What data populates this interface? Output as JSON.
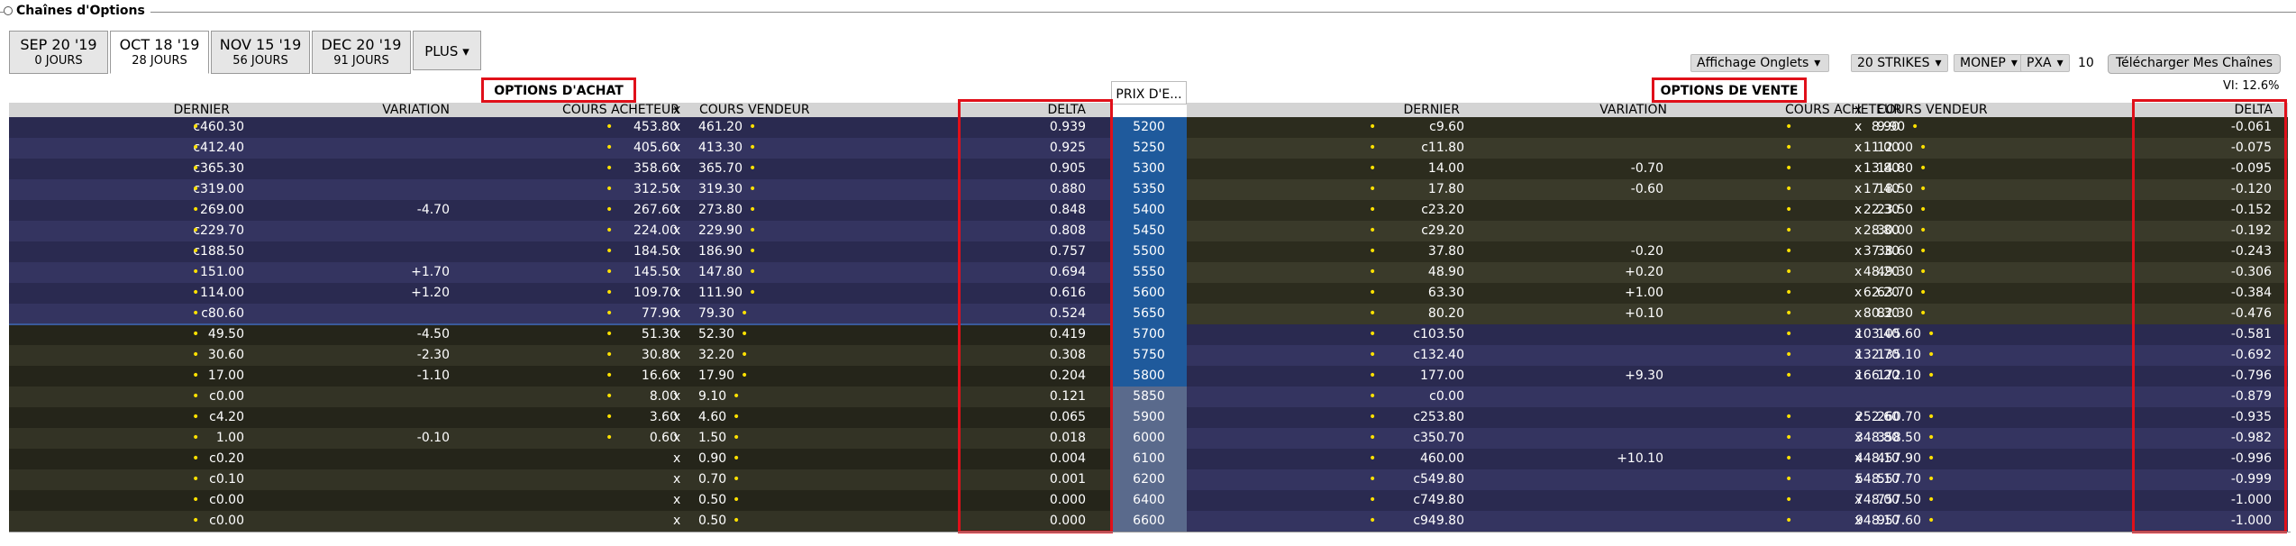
{
  "header": {
    "title": "Chaînes d'Options"
  },
  "tabs": [
    {
      "label": "SEP 20 '19",
      "sub": "0 JOURS",
      "active": false
    },
    {
      "label": "OCT 18 '19",
      "sub": "28 JOURS",
      "active": true
    },
    {
      "label": "NOV 15 '19",
      "sub": "56 JOURS",
      "active": false
    },
    {
      "label": "DEC 20 '19",
      "sub": "91 JOURS",
      "active": false
    }
  ],
  "plus": {
    "label": "PLUS"
  },
  "controls": {
    "affichage": "Affichage Onglets",
    "strikes": "20 STRIKES",
    "exchange": "MONEP",
    "pxa": "PXA",
    "pxa_value": "10",
    "download": "Télécharger Mes Chaînes",
    "vi": "VI: 12.6%"
  },
  "calls": {
    "title": "OPTIONS D'ACHAT",
    "headers": {
      "dernier": "DERNIER",
      "variation": "VARIATION",
      "bid": "COURS ACHETEUR",
      "x": "x",
      "ask": "COURS VENDEUR",
      "delta": "DELTA"
    }
  },
  "puts": {
    "title": "OPTIONS DE VENTE",
    "headers": {
      "dernier": "DERNIER",
      "variation": "VARIATION",
      "bid": "COURS ACHETEUR",
      "x": "x",
      "ask": "COURS VENDEUR",
      "delta": "DELTA"
    }
  },
  "strike_header": "PRIX D'E...",
  "colors": {
    "call_itm_a": "#2a2a50",
    "call_itm_b": "#343460",
    "call_otm_a": "#25251a",
    "call_otm_b": "#333325",
    "strike_itm": "#1f5a9c",
    "strike_otm": "#5a6a8c",
    "put_otm_a": "#2c2c1e",
    "put_otm_b": "#3a3a2a",
    "put_itm_a": "#2a2a50",
    "put_itm_b": "#343460",
    "accent_red": "#e0101a"
  },
  "rows": [
    {
      "strike": "5200",
      "call": {
        "last": "c460.30",
        "var": "",
        "bid": "453.80",
        "ask": "461.20",
        "delta": "0.939"
      },
      "put": {
        "last": "c9.60",
        "var": "",
        "bid": "8.90",
        "ask": "9.90",
        "delta": "-0.061"
      }
    },
    {
      "strike": "5250",
      "call": {
        "last": "c412.40",
        "var": "",
        "bid": "405.60",
        "ask": "413.30",
        "delta": "0.925"
      },
      "put": {
        "last": "c11.80",
        "var": "",
        "bid": "11.00",
        "ask": "12.00",
        "delta": "-0.075"
      }
    },
    {
      "strike": "5300",
      "call": {
        "last": "c365.30",
        "var": "",
        "bid": "358.60",
        "ask": "365.70",
        "delta": "0.905"
      },
      "put": {
        "last": "14.00",
        "var": "-0.70",
        "bid": "13.80",
        "ask": "14.80",
        "delta": "-0.095"
      }
    },
    {
      "strike": "5350",
      "call": {
        "last": "c319.00",
        "var": "",
        "bid": "312.50",
        "ask": "319.30",
        "delta": "0.880"
      },
      "put": {
        "last": "17.80",
        "var": "-0.60",
        "bid": "17.40",
        "ask": "18.50",
        "delta": "-0.120"
      }
    },
    {
      "strike": "5400",
      "call": {
        "last": "269.00",
        "var": "-4.70",
        "bid": "267.60",
        "ask": "273.80",
        "delta": "0.848"
      },
      "put": {
        "last": "c23.20",
        "var": "",
        "bid": "22.30",
        "ask": "23.50",
        "delta": "-0.152"
      }
    },
    {
      "strike": "5450",
      "call": {
        "last": "c229.70",
        "var": "",
        "bid": "224.00",
        "ask": "229.90",
        "delta": "0.808"
      },
      "put": {
        "last": "c29.20",
        "var": "",
        "bid": "28.80",
        "ask": "30.00",
        "delta": "-0.192"
      }
    },
    {
      "strike": "5500",
      "call": {
        "last": "c188.50",
        "var": "",
        "bid": "184.50",
        "ask": "186.90",
        "delta": "0.757"
      },
      "put": {
        "last": "37.80",
        "var": "-0.20",
        "bid": "37.30",
        "ask": "38.60",
        "delta": "-0.243"
      }
    },
    {
      "strike": "5550",
      "call": {
        "last": "151.00",
        "var": "+1.70",
        "bid": "145.50",
        "ask": "147.80",
        "delta": "0.694"
      },
      "put": {
        "last": "48.90",
        "var": "+0.20",
        "bid": "48.20",
        "ask": "49.30",
        "delta": "-0.306"
      }
    },
    {
      "strike": "5600",
      "call": {
        "last": "114.00",
        "var": "+1.20",
        "bid": "109.70",
        "ask": "111.90",
        "delta": "0.616"
      },
      "put": {
        "last": "63.30",
        "var": "+1.00",
        "bid": "62.20",
        "ask": "63.70",
        "delta": "-0.384"
      }
    },
    {
      "strike": "5650",
      "call": {
        "last": "c80.60",
        "var": "",
        "bid": "77.90",
        "ask": "79.30",
        "delta": "0.524"
      },
      "put": {
        "last": "80.20",
        "var": "+0.10",
        "bid": "80.30",
        "ask": "82.30",
        "delta": "-0.476"
      }
    },
    {
      "strike": "5700",
      "call": {
        "last": "49.50",
        "var": "-4.50",
        "bid": "51.30",
        "ask": "52.30",
        "delta": "0.419"
      },
      "put": {
        "last": "c103.50",
        "var": "",
        "bid": "103.40",
        "ask": "105.60",
        "delta": "-0.581"
      }
    },
    {
      "strike": "5750",
      "call": {
        "last": "30.60",
        "var": "-2.30",
        "bid": "30.80",
        "ask": "32.20",
        "delta": "0.308"
      },
      "put": {
        "last": "c132.40",
        "var": "",
        "bid": "132.70",
        "ask": "135.10",
        "delta": "-0.692"
      }
    },
    {
      "strike": "5800",
      "call": {
        "last": "17.00",
        "var": "-1.10",
        "bid": "16.60",
        "ask": "17.90",
        "delta": "0.204"
      },
      "put": {
        "last": "177.00",
        "var": "+9.30",
        "bid": "166.20",
        "ask": "172.10",
        "delta": "-0.796"
      }
    },
    {
      "strike": "5850",
      "call": {
        "last": "c0.00",
        "var": "",
        "bid": "8.00",
        "ask": "9.10",
        "delta": "0.121"
      },
      "put": {
        "last": "c0.00",
        "var": "",
        "bid": "",
        "ask": "",
        "delta": "-0.879"
      }
    },
    {
      "strike": "5900",
      "call": {
        "last": "c4.20",
        "var": "",
        "bid": "3.60",
        "ask": "4.60",
        "delta": "0.065"
      },
      "put": {
        "last": "c253.80",
        "var": "",
        "bid": "252.60",
        "ask": "260.70",
        "delta": "-0.935"
      }
    },
    {
      "strike": "6000",
      "call": {
        "last": "1.00",
        "var": "-0.10",
        "bid": "0.60",
        "ask": "1.50",
        "delta": "0.018"
      },
      "put": {
        "last": "c350.70",
        "var": "",
        "bid": "348.80",
        "ask": "358.50",
        "delta": "-0.982"
      }
    },
    {
      "strike": "6100",
      "call": {
        "last": "c0.20",
        "var": "",
        "bid": "",
        "ask": "0.90",
        "delta": "0.004"
      },
      "put": {
        "last": "460.00",
        "var": "+10.10",
        "bid": "448.10",
        "ask": "457.90",
        "delta": "-0.996"
      }
    },
    {
      "strike": "6200",
      "call": {
        "last": "c0.10",
        "var": "",
        "bid": "",
        "ask": "0.70",
        "delta": "0.001"
      },
      "put": {
        "last": "c549.80",
        "var": "",
        "bid": "548.10",
        "ask": "557.70",
        "delta": "-0.999"
      }
    },
    {
      "strike": "6400",
      "call": {
        "last": "c0.00",
        "var": "",
        "bid": "",
        "ask": "0.50",
        "delta": "0.000"
      },
      "put": {
        "last": "c749.80",
        "var": "",
        "bid": "748.00",
        "ask": "757.50",
        "delta": "-1.000"
      }
    },
    {
      "strike": "6600",
      "call": {
        "last": "c0.00",
        "var": "",
        "bid": "",
        "ask": "0.50",
        "delta": "0.000"
      },
      "put": {
        "last": "c949.80",
        "var": "",
        "bid": "948.10",
        "ask": "957.60",
        "delta": "-1.000"
      }
    }
  ]
}
